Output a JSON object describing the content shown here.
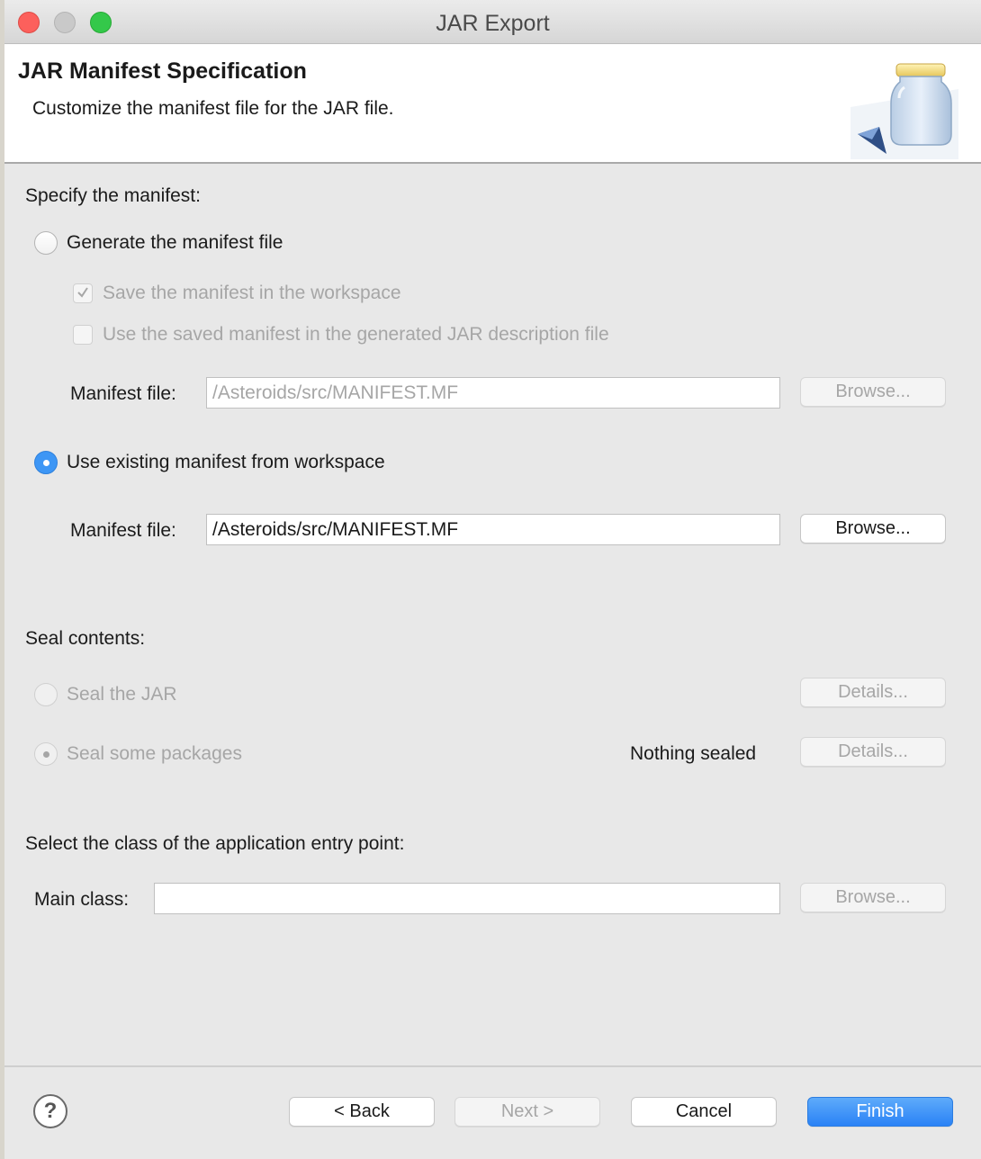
{
  "window": {
    "title": "JAR Export"
  },
  "banner": {
    "title": "JAR Manifest Specification",
    "description": "Customize the manifest file for the JAR file.",
    "icon": "jar-icon"
  },
  "manifest": {
    "heading": "Specify the manifest:",
    "generate_label": "Generate the manifest file",
    "save_label": "Save the manifest in the workspace",
    "use_saved_label": "Use the saved manifest in the generated JAR description file",
    "gen_file_label": "Manifest file:",
    "gen_file_value": "/Asteroids/src/MANIFEST.MF",
    "browse_label": "Browse...",
    "existing_label": "Use existing manifest from workspace",
    "existing_file_label": "Manifest file:",
    "existing_file_value": "/Asteroids/src/MANIFEST.MF",
    "existing_browse_label": "Browse..."
  },
  "seal": {
    "heading": "Seal contents:",
    "seal_jar_label": "Seal the JAR",
    "seal_jar_details": "Details...",
    "seal_some_label": "Seal some packages",
    "status": "Nothing sealed",
    "seal_some_details": "Details..."
  },
  "entry": {
    "heading": "Select the class of the application entry point:",
    "main_class_label": "Main class:",
    "main_class_value": "",
    "browse_label": "Browse..."
  },
  "footer": {
    "help": "?",
    "back": "< Back",
    "next": "Next >",
    "cancel": "Cancel",
    "finish": "Finish"
  },
  "colors": {
    "accent": "#3d96f5",
    "finish": "#2a82f6",
    "disabled_text": "#a6a6a6"
  }
}
